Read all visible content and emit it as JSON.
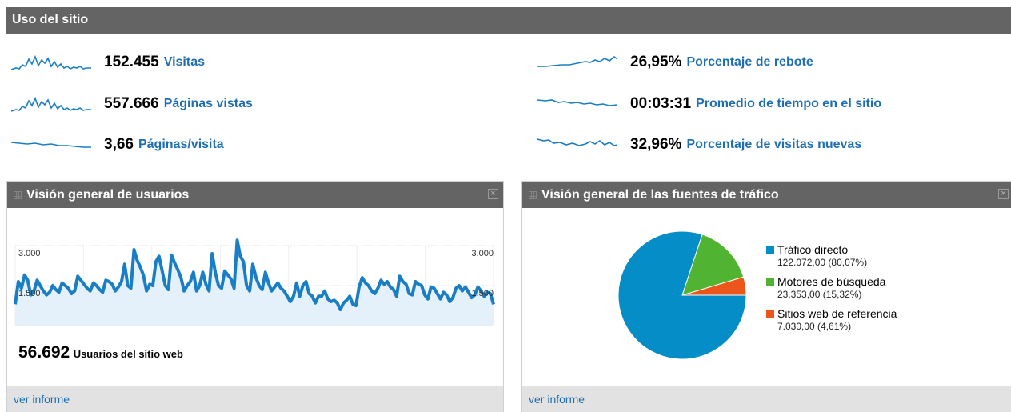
{
  "header": {
    "title": "Uso del sitio"
  },
  "metrics": {
    "visitas": {
      "value": "152.455",
      "label": "Visitas"
    },
    "paginas_vistas": {
      "value": "557.666",
      "label": "Páginas vistas"
    },
    "paginas_visita": {
      "value": "3,66",
      "label": "Páginas/visita"
    },
    "rebote": {
      "value": "26,95%",
      "label": "Porcentaje de rebote"
    },
    "tiempo": {
      "value": "00:03:31",
      "label": "Promedio de tiempo en el sitio"
    },
    "nuevas": {
      "value": "32,96%",
      "label": "Porcentaje de visitas nuevas"
    }
  },
  "users_panel": {
    "title": "Visión general de usuarios",
    "axis_top": "3.000",
    "axis_mid": "1.500",
    "total": "56.692",
    "total_label": "Usuarios del sitio web",
    "link": "ver informe"
  },
  "traffic_panel": {
    "title": "Visión general de las fuentes de tráfico",
    "link": "ver informe"
  },
  "colors": {
    "line": "#1a7ec4",
    "directo": "#058dc7",
    "motores": "#50b432",
    "referencia": "#ed561b"
  },
  "chart_data": [
    {
      "type": "line",
      "ylim": [
        0,
        3000
      ],
      "yticks": [
        "1.500",
        "3.000"
      ],
      "grid": true,
      "series": [
        {
          "values": [
            800,
            1650,
            1400,
            1900,
            1700,
            1150,
            1300,
            1700,
            1500,
            1300,
            1150,
            1250,
            1500,
            1350,
            1250,
            1600,
            1500,
            1400,
            1200,
            1300,
            1850,
            1700,
            1550,
            1400,
            1300,
            1600,
            1500,
            1350,
            1250,
            1700,
            1650,
            1550,
            1300,
            1450,
            1650,
            2300,
            1500,
            1400,
            2850,
            2450,
            2200,
            1900,
            1300,
            1550,
            1500,
            2400,
            2600,
            2050,
            1500,
            1350,
            2650,
            2350,
            2100,
            1800,
            1300,
            1500,
            1650,
            2000,
            1300,
            1500,
            2000,
            1550,
            1300,
            2700,
            2000,
            1500,
            1400,
            2050,
            1900,
            1750,
            1400,
            3200,
            2600,
            2400,
            1500,
            1300,
            2300,
            1800,
            1500,
            1350,
            2000,
            1600,
            1300,
            1450,
            1600,
            1400,
            1300,
            1100,
            900,
            1100,
            1600,
            1100,
            1500,
            1650,
            1200,
            1100,
            850,
            1100,
            1100,
            1300,
            1000,
            900,
            950,
            850,
            600,
            850,
            950,
            1100,
            800,
            750,
            1450,
            1800,
            1600,
            1500,
            1300,
            1200,
            1400,
            1700,
            1550,
            1650,
            1450,
            1350,
            1100,
            1850,
            1650,
            1550,
            1200,
            1150,
            1650,
            1550,
            1500,
            1150,
            1000,
            1450,
            1400,
            1200,
            1000,
            1250,
            1150,
            900,
            1050,
            1400,
            1500,
            1300,
            1450,
            1250,
            1050,
            1150,
            1450,
            1300,
            1100,
            1250,
            1200,
            800
          ]
        }
      ]
    },
    {
      "type": "pie",
      "series": [
        {
          "name": "Tráfico directo",
          "value": 122072.0,
          "label": "122.072,00 (80,07%)"
        },
        {
          "name": "Motores de búsqueda",
          "value": 23353.0,
          "label": "23.353,00 (15,32%)"
        },
        {
          "name": "Sitios web de referencia",
          "value": 7030.0,
          "label": "7.030,00 (4,61%)"
        }
      ]
    }
  ]
}
